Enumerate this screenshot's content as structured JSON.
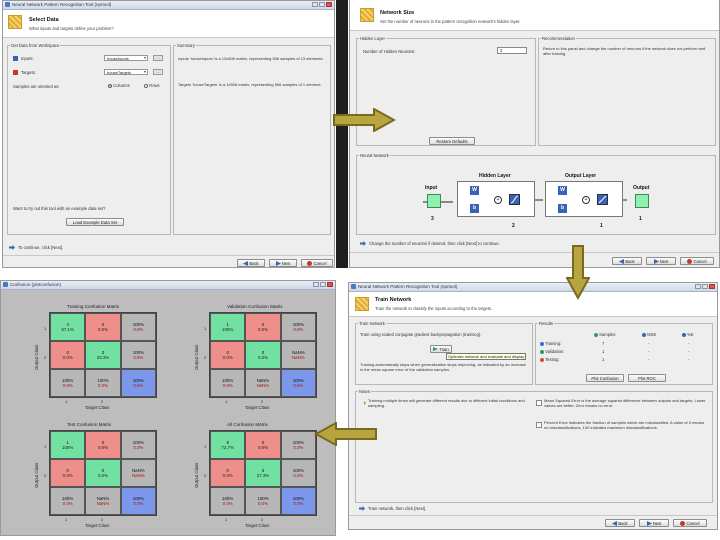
{
  "colors": {
    "accent": "#3a63b8",
    "green_cell": "#72e0a0",
    "red_cell": "#ef8f8c",
    "gray_cell": "#b7b7b7",
    "blue_cell": "#7b98ea",
    "arrow_fill": "#b8a540",
    "arrow_stroke": "#7a6a1e"
  },
  "select_data": {
    "window_title": "Neural Network Pattern Recognition Tool (nprtool)",
    "title": "Select Data",
    "subtitle": "What inputs and targets define your problem?",
    "panel_left": "Get Data from Workspace",
    "panel_right": "Summary",
    "inputs_label": "Inputs:",
    "inputs_value": "houseInputs",
    "targets_label": "Targets:",
    "targets_value": "houseTargets",
    "ellipsis": "...",
    "samples_label": "Samples are oriented as:",
    "columns_label": "Columns",
    "rows_label": "Rows",
    "summary_inputs": "Inputs 'houseInputs' is a 13x506 matrix, representing 506 samples of 13 elements.",
    "summary_targets": "Targets 'houseTargets' is a 1x506 matrix, representing 506 samples of 1 element.",
    "example_prompt": "Want to try out this tool with an example data set?",
    "load_example": "Load Example Data Set",
    "hint": "To continue, click [Next].",
    "back": "Back",
    "next": "Next",
    "cancel": "Cancel"
  },
  "network_size": {
    "title": "Network Size",
    "subtitle": "Set the number of neurons in the pattern recognition network's hidden layer.",
    "hidden_panel": "Hidden Layer",
    "recommendation_panel": "Recommendation",
    "hidden_label": "Number of Hidden Neurons:",
    "hidden_value": "2",
    "recommendation_text": "Return to this panel and change the number of neurons if the network does not perform well after training.",
    "restore_defaults": "Restore Defaults",
    "nn_panel": "Neural Network",
    "input_label": "Input",
    "hidden_layer_label": "Hidden Layer",
    "output_layer_label": "Output Layer",
    "output_label": "Output",
    "w": "W",
    "b": "b",
    "plus": "+",
    "input_size": "3",
    "hidden_size": "2",
    "output_layer_size": "1",
    "output_size": "1",
    "hint": "Change the number of neurons if desired, then click [Next] to continue.",
    "back": "Back",
    "next": "Next",
    "cancel": "Cancel"
  },
  "train_network": {
    "window_title": "Neural Network Pattern Recognition Tool (nprtool)",
    "title": "Train Network",
    "subtitle": "Train the network to classify the inputs according to the targets.",
    "train_panel": "Train Network",
    "results_panel": "Results",
    "train_desc": "Train using scaled conjugate gradient backpropagation (trainscg).",
    "train_button": "Train",
    "tooltip": "Optimize network and evaluate and display",
    "train_note": "Training automatically stops when generalization stops improving, as indicated by an increase in the mean square error of the validation samples.",
    "col_samples": "Samples",
    "col_mse": "MSE",
    "col_e": "%E",
    "rows": [
      {
        "label": "Training:",
        "samples": "7",
        "mse": "-",
        "e": "-",
        "color": "#2e6fd6"
      },
      {
        "label": "Validation:",
        "samples": "1",
        "mse": "-",
        "e": "-",
        "color": "#2aa05a"
      },
      {
        "label": "Testing:",
        "samples": "1",
        "mse": "-",
        "e": "-",
        "color": "#d64a2e"
      }
    ],
    "plot_confusion": "Plot Confusion",
    "plot_roc": "Plot ROC",
    "notes_panel": "Notes",
    "note_left": "Training multiple times will generate different results due to different initial conditions and sampling.",
    "note_mse": "Mean Squared Error is the average squared difference between outputs and targets. Lower values are better. Zero means no error.",
    "note_e": "Percent Error indicates the fraction of samples which are misclassified. A value of 0 means no misclassifications, 100 indicates maximum misclassifications.",
    "hint": "Train network, then click [Next].",
    "back": "Back",
    "next": "Next",
    "cancel": "Cancel"
  },
  "confusion": {
    "window_title": "Confusion (plotconfusion)",
    "output_class": "Output Class",
    "target_class": "Target Class",
    "ticks": [
      "1",
      "2"
    ],
    "matrices": [
      {
        "title": "Training Confusion Matrix",
        "cells": [
          [
            "4",
            "57.1%",
            "g"
          ],
          [
            "0",
            "0.0%",
            "r"
          ],
          [
            "100%",
            "0.0%",
            "gr"
          ],
          [
            "0",
            "0.0%",
            "r"
          ],
          [
            "3",
            "33.3%",
            "g"
          ],
          [
            "100%",
            "0.0%",
            "gr"
          ],
          [
            "100%",
            "0.0%",
            "gr"
          ],
          [
            "100%",
            "0.0%",
            "gr"
          ],
          [
            "100%",
            "0.0%",
            "b"
          ]
        ]
      },
      {
        "title": "Validation Confusion Matrix",
        "cells": [
          [
            "1",
            "100%",
            "g"
          ],
          [
            "0",
            "0.0%",
            "r"
          ],
          [
            "100%",
            "0.0%",
            "gr"
          ],
          [
            "0",
            "0.0%",
            "r"
          ],
          [
            "0",
            "0.0%",
            "g"
          ],
          [
            "NaN%",
            "NaN%",
            "gr"
          ],
          [
            "100%",
            "0.0%",
            "gr"
          ],
          [
            "NaN%",
            "NaN%",
            "gr"
          ],
          [
            "100%",
            "0.0%",
            "b"
          ]
        ]
      },
      {
        "title": "Test Confusion Matrix",
        "cells": [
          [
            "1",
            "100%",
            "g"
          ],
          [
            "0",
            "0.0%",
            "r"
          ],
          [
            "100%",
            "0.0%",
            "gr"
          ],
          [
            "0",
            "0.0%",
            "r"
          ],
          [
            "0",
            "0.0%",
            "g"
          ],
          [
            "NaN%",
            "NaN%",
            "gr"
          ],
          [
            "100%",
            "0.0%",
            "gr"
          ],
          [
            "NaN%",
            "NaN%",
            "gr"
          ],
          [
            "100%",
            "0.0%",
            "b"
          ]
        ]
      },
      {
        "title": "All Confusion Matrix",
        "cells": [
          [
            "8",
            "72.7%",
            "g"
          ],
          [
            "0",
            "0.0%",
            "r"
          ],
          [
            "100%",
            "0.0%",
            "gr"
          ],
          [
            "0",
            "0.0%",
            "r"
          ],
          [
            "3",
            "27.3%",
            "g"
          ],
          [
            "100%",
            "0.0%",
            "gr"
          ],
          [
            "100%",
            "0.0%",
            "gr"
          ],
          [
            "100%",
            "0.0%",
            "gr"
          ],
          [
            "100%",
            "0.0%",
            "b"
          ]
        ]
      }
    ]
  }
}
